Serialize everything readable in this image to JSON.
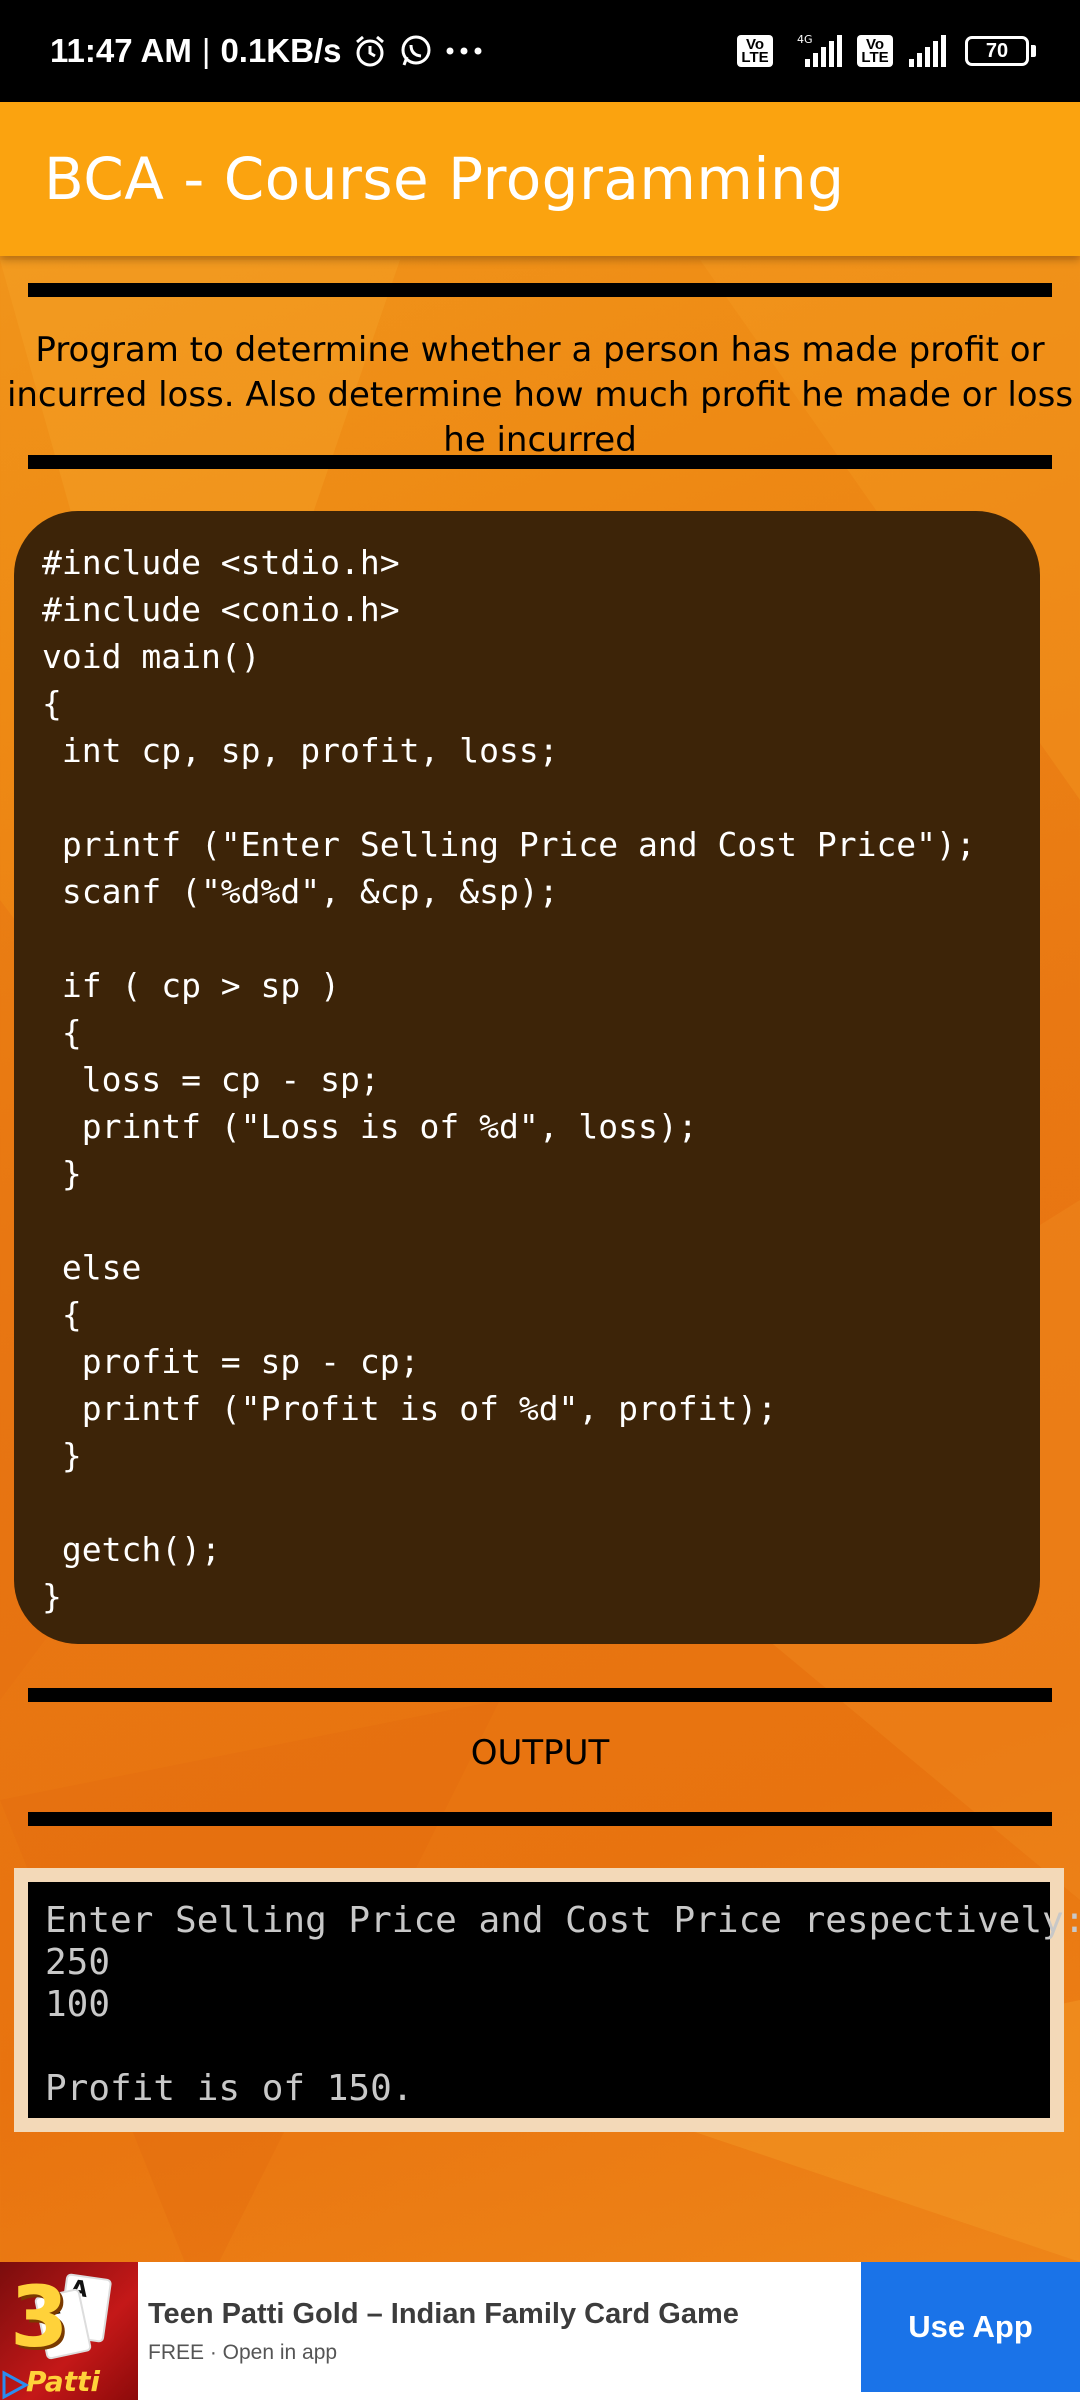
{
  "status_bar": {
    "time": "11:47 AM",
    "separator": "|",
    "data_speed": "0.1KB/s",
    "network_label": "4G",
    "volte_label": "Vo\nLTE",
    "battery": "70",
    "icons": [
      "alarm-icon",
      "whatsapp-icon",
      "more-dots-icon",
      "volte-icon",
      "signal-icon",
      "battery-icon"
    ]
  },
  "app_bar": {
    "title": "BCA - Course Programming",
    "color": "#fba30f"
  },
  "description": "Program to determine whether a person has made profit or incurred loss. Also determine how much profit he made or loss he incurred",
  "code_lines": [
    "#include <stdio.h>",
    "#include <conio.h>",
    "void main()",
    "{",
    " int cp, sp, profit, loss;",
    "",
    " printf (\"Enter Selling Price and Cost Price\");",
    " scanf (\"%d%d\", &cp, &sp);",
    "",
    " if ( cp > sp )",
    " {",
    "  loss = cp - sp;",
    "  printf (\"Loss is of %d\", loss);",
    " }",
    "",
    " else",
    " {",
    "  profit = sp - cp;",
    "  printf (\"Profit is of %d\", profit);",
    " }",
    "",
    " getch();",
    "}"
  ],
  "output_label": "OUTPUT",
  "console_lines": [
    "Enter Selling Price and Cost Price respectively:",
    "250",
    "100",
    "",
    "Profit is of 150."
  ],
  "ad": {
    "title": "Teen Patti Gold – Indian Family Card Game",
    "subtitle": "FREE · Open in app",
    "button": "Use App",
    "logo_text": "3",
    "logo_word": "Patti",
    "button_color": "#1a73e8"
  }
}
